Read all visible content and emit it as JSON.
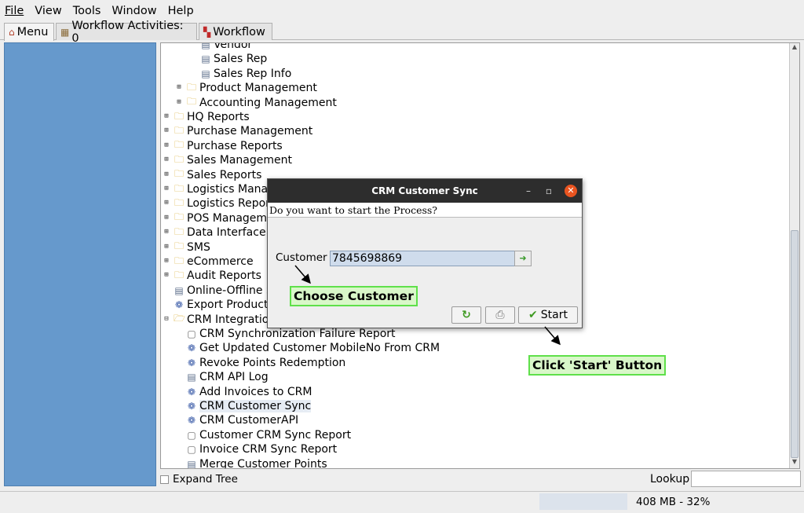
{
  "menubar": {
    "items": [
      "File",
      "View",
      "Tools",
      "Window",
      "Help"
    ]
  },
  "tabs": [
    {
      "label": "Menu",
      "icon": "home-icon"
    },
    {
      "label": "Workflow Activities: 0",
      "icon": "calendar-icon"
    },
    {
      "label": "Workflow",
      "icon": "workflow-icon"
    }
  ],
  "tree": {
    "items": [
      {
        "label": "Vendor",
        "icon": "document-icon",
        "expander": ""
      },
      {
        "label": "Sales Rep",
        "icon": "document-icon",
        "expander": ""
      },
      {
        "label": "Sales Rep Info",
        "icon": "document-icon",
        "expander": ""
      },
      {
        "label": "Product Management",
        "icon": "folder-icon",
        "expander": "+"
      },
      {
        "label": "Accounting Management",
        "icon": "folder-icon",
        "expander": "+"
      },
      {
        "label": "HQ Reports",
        "icon": "folder-icon",
        "expander": "+"
      },
      {
        "label": "Purchase Management",
        "icon": "folder-icon",
        "expander": "+"
      },
      {
        "label": "Purchase Reports",
        "icon": "folder-icon",
        "expander": "+"
      },
      {
        "label": "Sales Management",
        "icon": "folder-icon",
        "expander": "+"
      },
      {
        "label": "Sales Reports",
        "icon": "folder-icon",
        "expander": "+"
      },
      {
        "label": "Logistics Management",
        "icon": "folder-icon",
        "expander": "+"
      },
      {
        "label": "Logistics Reports",
        "icon": "folder-icon",
        "expander": "+"
      },
      {
        "label": "POS Management",
        "icon": "folder-icon",
        "expander": "+"
      },
      {
        "label": "Data Interface",
        "icon": "folder-icon",
        "expander": "+"
      },
      {
        "label": "SMS",
        "icon": "folder-icon",
        "expander": "+"
      },
      {
        "label": "eCommerce",
        "icon": "folder-icon",
        "expander": "+"
      },
      {
        "label": "Audit Reports",
        "icon": "folder-icon",
        "expander": "+"
      },
      {
        "label": "Online-Offline S",
        "icon": "document-icon",
        "expander": ""
      },
      {
        "label": "Export Product",
        "icon": "process-gear-icon",
        "expander": ""
      },
      {
        "label": "CRM Integration",
        "icon": "folder-open-icon",
        "expander": "-"
      },
      {
        "label": "CRM Synchronization Failure Report",
        "icon": "report-icon",
        "expander": ""
      },
      {
        "label": "Get Updated Customer MobileNo From CRM",
        "icon": "process-gear-icon",
        "expander": ""
      },
      {
        "label": "Revoke Points Redemption",
        "icon": "process-gear-icon",
        "expander": ""
      },
      {
        "label": "CRM API Log",
        "icon": "document-icon",
        "expander": ""
      },
      {
        "label": "Add Invoices to CRM",
        "icon": "process-gear-icon",
        "expander": ""
      },
      {
        "label": "CRM Customer Sync",
        "icon": "process-gear-icon",
        "expander": ""
      },
      {
        "label": "CRM CustomerAPI",
        "icon": "process-gear-icon",
        "expander": ""
      },
      {
        "label": "Customer CRM Sync Report",
        "icon": "report-icon",
        "expander": ""
      },
      {
        "label": "Invoice CRM Sync Report",
        "icon": "report-icon",
        "expander": ""
      },
      {
        "label": "Merge Customer Points",
        "icon": "document-icon",
        "expander": ""
      }
    ]
  },
  "bottom": {
    "expand_tree_label": "Expand Tree",
    "lookup_label": "Lookup",
    "lookup_value": ""
  },
  "status": {
    "memory": "408 MB - 32%"
  },
  "dialog": {
    "title": "CRM Customer Sync",
    "question": "Do you want to start the Process?",
    "customer_label": "Customer",
    "customer_value": "7845698869",
    "start_label": "Start"
  },
  "annotations": {
    "choose_customer": "Choose Customer",
    "click_start": "Click 'Start' Button"
  }
}
